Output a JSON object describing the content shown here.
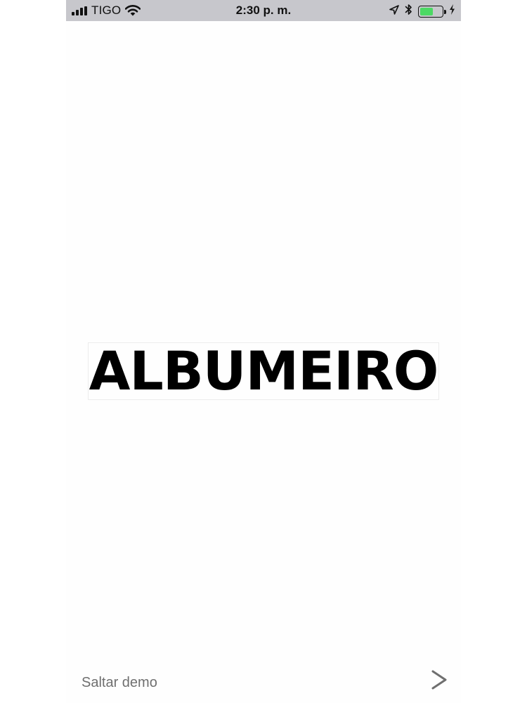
{
  "status_bar": {
    "carrier": "TIGO",
    "time": "2:30 p. m.",
    "signal_bars": 4,
    "battery_level": 0.6,
    "battery_color": "#4cd964",
    "icons": [
      "signal-icon",
      "wifi-icon",
      "location-icon",
      "bluetooth-icon",
      "battery-icon",
      "charging-icon"
    ]
  },
  "splash": {
    "logo_text": "ALBUMEIRO"
  },
  "footer": {
    "skip_label": "Saltar demo",
    "next_icon": "chevron-right-icon"
  }
}
